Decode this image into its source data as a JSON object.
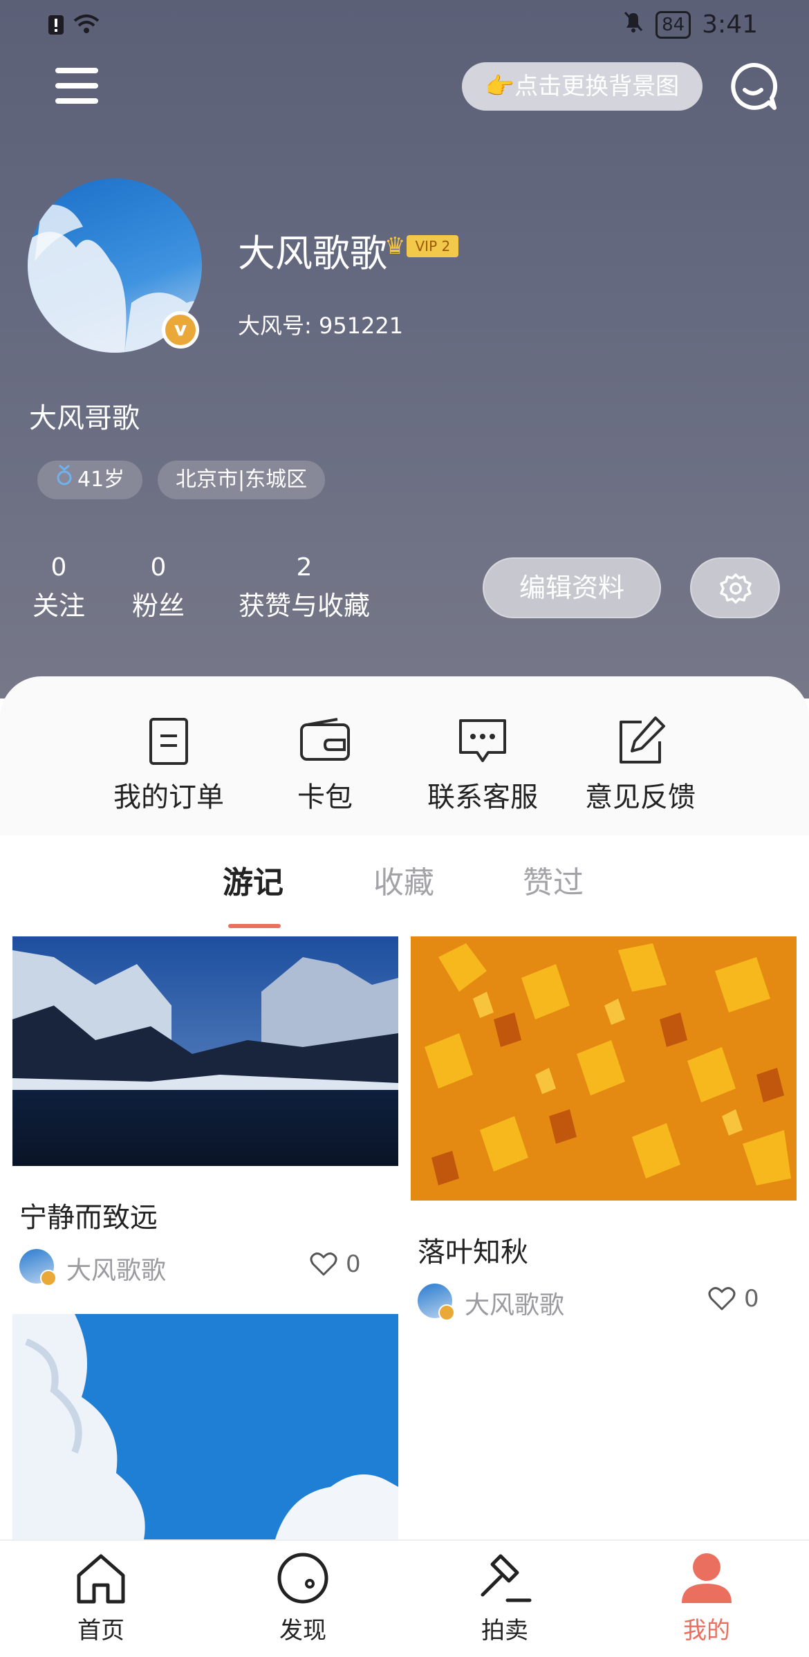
{
  "status_bar": {
    "time": "3:41",
    "battery": "84"
  },
  "header": {
    "change_bg_label": "👉点击更换背景图",
    "nickname": "大风歌歌",
    "vip_label": "VIP 2",
    "account_id": "大风号: 951221",
    "signature": "大风哥歌",
    "tags": [
      {
        "icon": "male-icon",
        "label": "41岁"
      },
      {
        "label": "北京市|东城区"
      }
    ],
    "stats": [
      {
        "value": "0",
        "label": "关注"
      },
      {
        "value": "0",
        "label": "粉丝"
      },
      {
        "value": "2",
        "label": "获赞与收藏"
      }
    ],
    "edit_profile_label": "编辑资料"
  },
  "quick_actions": [
    {
      "icon": "order-icon",
      "label": "我的订单"
    },
    {
      "icon": "wallet-icon",
      "label": "卡包"
    },
    {
      "icon": "customer-service-icon",
      "label": "联系客服"
    },
    {
      "icon": "feedback-icon",
      "label": "意见反馈"
    }
  ],
  "tabs": [
    {
      "label": "游记",
      "active": true
    },
    {
      "label": "收藏",
      "active": false
    },
    {
      "label": "赞过",
      "active": false
    }
  ],
  "feed": [
    {
      "title": "宁静而致远",
      "author": "大风歌歌",
      "likes": "0"
    },
    {
      "title": "落叶知秋",
      "author": "大风歌歌",
      "likes": "0"
    },
    {
      "title": "",
      "author": "",
      "likes": ""
    }
  ],
  "bottom_nav": [
    {
      "icon": "home-icon",
      "label": "首页",
      "active": false
    },
    {
      "icon": "discover-icon",
      "label": "发现",
      "active": false
    },
    {
      "icon": "auction-icon",
      "label": "拍卖",
      "active": false
    },
    {
      "icon": "profile-icon",
      "label": "我的",
      "active": true
    }
  ],
  "colors": {
    "accent": "#ea6f5e",
    "header_bg": "#62667c",
    "vip": "#f3c94b"
  }
}
